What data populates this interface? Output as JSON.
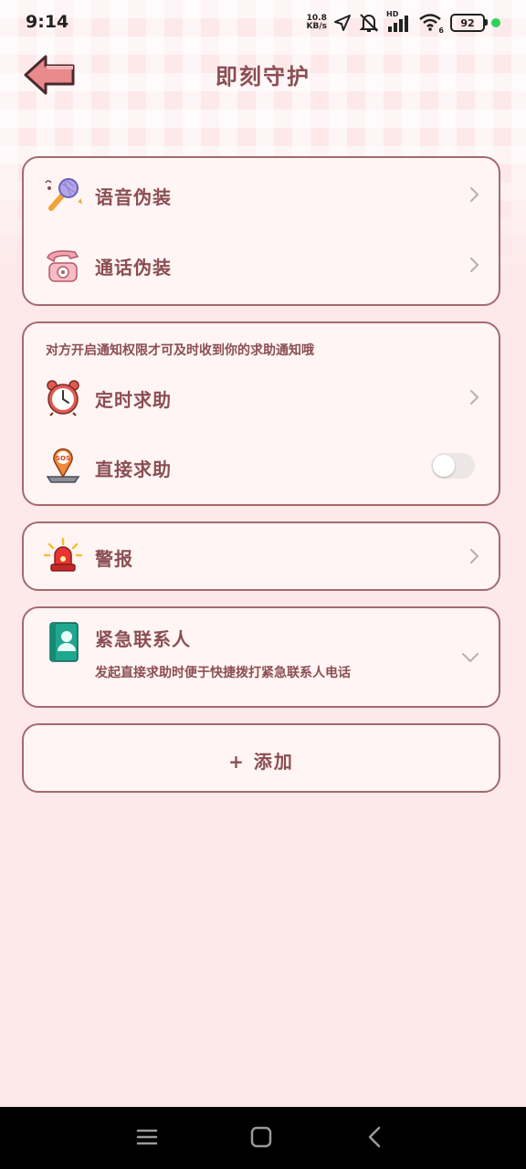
{
  "status_bar": {
    "time": "9:14",
    "net_speed_value": "10.8",
    "net_speed_unit": "KB/s",
    "battery": "92",
    "signal_tag": "HD",
    "wifi_tag": "6"
  },
  "header": {
    "title": "即刻守护"
  },
  "disguise_card": {
    "items": [
      {
        "label": "语音伪装",
        "icon": "microphone-icon"
      },
      {
        "label": "通话伪装",
        "icon": "telephone-icon"
      }
    ]
  },
  "help_card": {
    "note": "对方开启通知权限才可及时收到你的求助通知哦",
    "items": [
      {
        "label": "定时求助",
        "icon": "alarm-clock-icon"
      },
      {
        "label": "直接求助",
        "icon": "sos-icon",
        "toggle_on": false
      }
    ]
  },
  "alarm_card": {
    "label": "警报",
    "icon": "siren-icon"
  },
  "contacts_card": {
    "label": "紧急联系人",
    "description": "发起直接求助时便于快捷拨打紧急联系人电话",
    "icon": "contact-book-icon"
  },
  "add_button": {
    "label": "+ 添加"
  },
  "colors": {
    "accent_text": "#8b4e53",
    "card_border": "#a46a6e",
    "card_bg": "#fff5f4",
    "page_bg": "#fde9ea"
  }
}
